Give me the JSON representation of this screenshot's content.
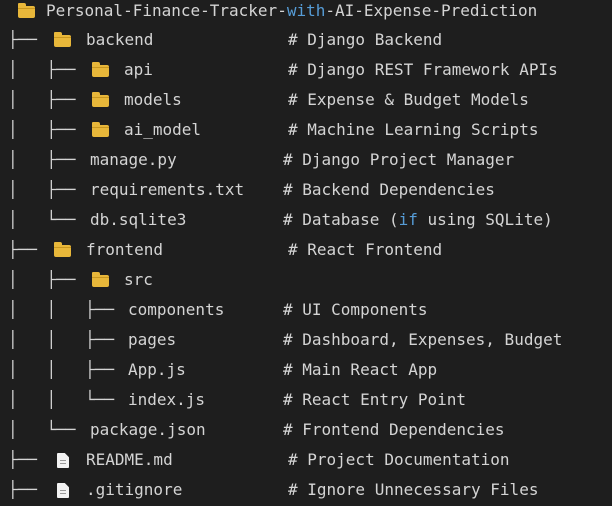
{
  "root": {
    "prefix": "📁 ",
    "name_start": "Personal-Finance-Tracker-",
    "name_keyword": "with",
    "name_end": "-AI-Expense-Prediction"
  },
  "rows": [
    {
      "prefix": "├── ",
      "icon": "folder-icon",
      "name": "backend",
      "comment": "# Django Backend"
    },
    {
      "prefix": "│   ├── ",
      "icon": "folder-icon",
      "name": "api",
      "comment": "# Django REST Framework APIs"
    },
    {
      "prefix": "│   ├── ",
      "icon": "folder-icon",
      "name": "models",
      "comment": "# Expense & Budget Models"
    },
    {
      "prefix": "│   ├── ",
      "icon": "folder-icon",
      "name": "ai_model",
      "comment": "# Machine Learning Scripts"
    },
    {
      "prefix": "│   ├── ",
      "icon": "",
      "name": "manage.py",
      "comment": "# Django Project Manager"
    },
    {
      "prefix": "│   ├── ",
      "icon": "",
      "name": "requirements.txt",
      "comment": "# Backend Dependencies"
    },
    {
      "prefix": "│   └── ",
      "icon": "",
      "name": "db.sqlite3",
      "comment_pre": "# Database (",
      "comment_kw": "if",
      "comment_post": " using SQLite)"
    },
    {
      "prefix": "├── ",
      "icon": "folder-icon",
      "name": "frontend",
      "comment": "# React Frontend"
    },
    {
      "prefix": "│   ├── ",
      "icon": "folder-icon",
      "name": "src",
      "comment": ""
    },
    {
      "prefix": "│   │   ├── ",
      "icon": "",
      "name": "components",
      "comment": "# UI Components"
    },
    {
      "prefix": "│   │   ├── ",
      "icon": "",
      "name": "pages",
      "comment": "# Dashboard, Expenses, Budget"
    },
    {
      "prefix": "│   │   ├── ",
      "icon": "",
      "name": "App.js",
      "comment": "# Main React App"
    },
    {
      "prefix": "│   │   └── ",
      "icon": "",
      "name": "index.js",
      "comment": "# React Entry Point"
    },
    {
      "prefix": "│   └── ",
      "icon": "",
      "name": "package.json",
      "comment": "# Frontend Dependencies"
    },
    {
      "prefix": "├── ",
      "icon": "file-icon",
      "name": "README.md",
      "comment": "# Project Documentation"
    },
    {
      "prefix": "├── ",
      "icon": "file-icon",
      "name": ".gitignore",
      "comment": "# Ignore Unnecessary Files"
    }
  ]
}
